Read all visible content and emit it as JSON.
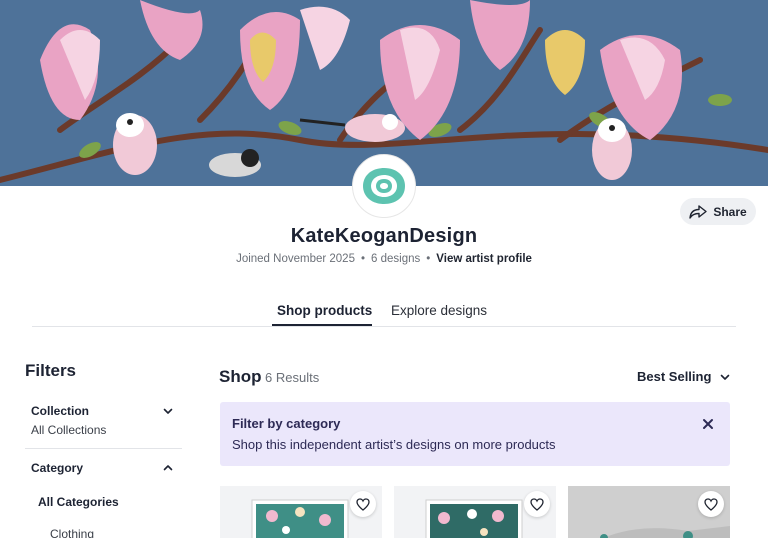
{
  "profile": {
    "name": "KateKeoganDesign",
    "joined": "Joined November 2025",
    "designs": "6 designs",
    "artist_link": "View artist profile",
    "share_label": "Share"
  },
  "tabs": [
    {
      "label": "Shop products",
      "active": true
    },
    {
      "label": "Explore designs",
      "active": false
    }
  ],
  "filters": {
    "title": "Filters",
    "collection": {
      "label": "Collection",
      "value": "All Collections"
    },
    "category": {
      "label": "Category",
      "all": "All Categories",
      "items": [
        "Clothing"
      ]
    }
  },
  "shop": {
    "title": "Shop",
    "count": "6 Results",
    "sort": "Best Selling"
  },
  "category_banner": {
    "title": "Filter by category",
    "text": "Shop this independent artist’s designs on more products"
  },
  "colors": {
    "banner_bg": "#4e7299",
    "magnolia_pink": "#e9a3c4",
    "banner_note_bg": "#ebe7fb",
    "avatar_teal": "#5dc3b0"
  }
}
